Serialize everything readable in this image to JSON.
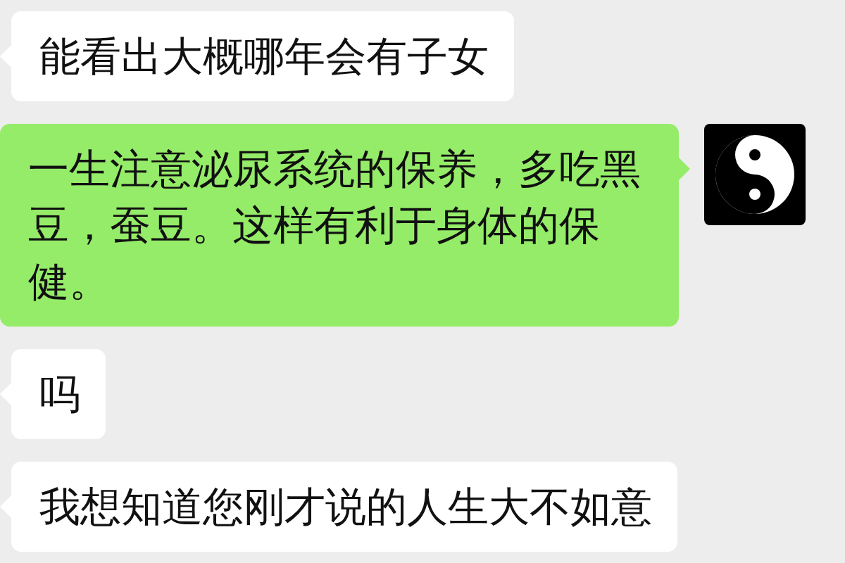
{
  "messages": [
    {
      "kind": "received",
      "text": "能看出大概哪年会有子女"
    },
    {
      "kind": "sent",
      "text": "一生注意泌尿系统的保养，多吃黑豆，蚕豆。这样有利于身体的保健。",
      "avatar": {
        "kind": "yin-yang"
      }
    },
    {
      "kind": "received",
      "text": "吗"
    },
    {
      "kind": "received",
      "text": "我想知道您刚才说的人生大不如意"
    }
  ]
}
